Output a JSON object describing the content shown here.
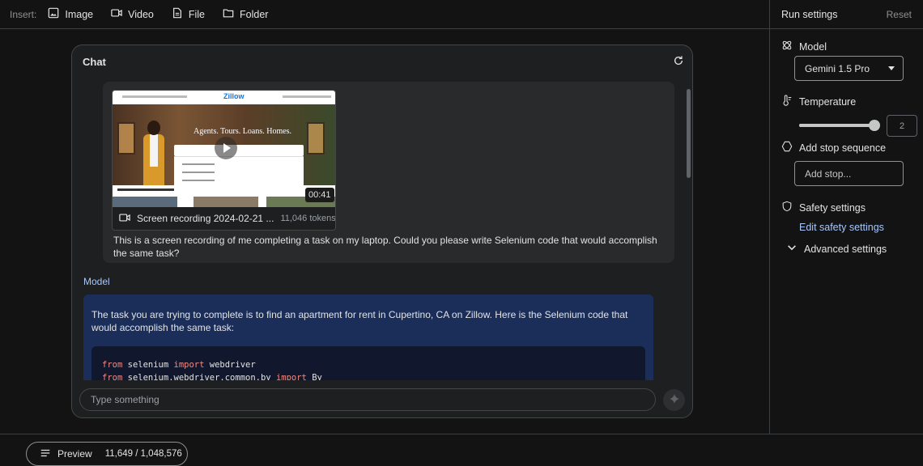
{
  "insert_bar": {
    "label": "Insert:",
    "buttons": [
      {
        "label": "Image",
        "icon": "image-icon"
      },
      {
        "label": "Video",
        "icon": "video-icon"
      },
      {
        "label": "File",
        "icon": "file-icon"
      },
      {
        "label": "Folder",
        "icon": "folder-icon"
      }
    ]
  },
  "chat": {
    "title": "Chat",
    "user_message": {
      "attachment": {
        "duration": "00:41",
        "name": "Screen recording 2024-02-21 ...",
        "tokens": "11,046 tokens",
        "thumbnail_logo": "Zillow",
        "thumbnail_headline": "Agents. Tours. Loans. Homes."
      },
      "text": "This is a screen recording of me completing a task on my laptop. Could you please write Selenium code that would accomplish the same task?"
    },
    "model_label": "Model",
    "model_message": {
      "text": "The task you are trying to complete is to find an apartment for rent in Cupertino, CA on Zillow. Here is the Selenium code that would accomplish the same task:",
      "code_lines": [
        {
          "kw1": "from",
          "mod": " selenium ",
          "kw2": "import",
          "name": " webdriver"
        },
        {
          "kw1": "from",
          "mod": " selenium.webdriver.common.by ",
          "kw2": "import",
          "name": " By"
        }
      ]
    },
    "input_placeholder": "Type something"
  },
  "run_settings": {
    "title": "Run settings",
    "reset": "Reset",
    "model_label": "Model",
    "model_value": "Gemini 1.5 Pro",
    "temperature_label": "Temperature",
    "temperature_value": "2",
    "temperature_fraction": 1.0,
    "stop_label": "Add stop sequence",
    "stop_placeholder": "Add stop...",
    "safety_label": "Safety settings",
    "safety_link": "Edit safety settings",
    "advanced_label": "Advanced settings"
  },
  "bottom": {
    "preview_label": "Preview",
    "token_count": "11,649 / 1,048,576"
  },
  "colors": {
    "background": "#131314",
    "card": "#1e1f20",
    "accent_link": "#a8c7fa",
    "model_bubble": "#1b2e5a",
    "code_keyword": "#f28b82"
  }
}
